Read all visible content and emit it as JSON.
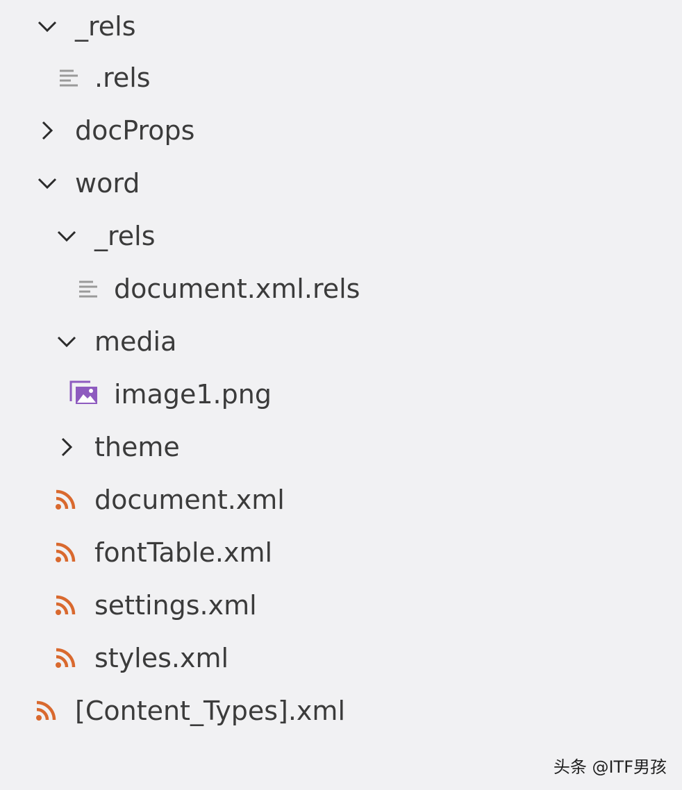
{
  "tree": {
    "items": [
      {
        "label": "_rels",
        "icon": "chevron-down-icon"
      },
      {
        "label": ".rels",
        "icon": "text-file-icon"
      },
      {
        "label": "docProps",
        "icon": "chevron-right-icon"
      },
      {
        "label": "word",
        "icon": "chevron-down-icon"
      },
      {
        "label": "_rels",
        "icon": "chevron-down-icon"
      },
      {
        "label": "document.xml.rels",
        "icon": "text-file-icon"
      },
      {
        "label": "media",
        "icon": "chevron-down-icon"
      },
      {
        "label": "image1.png",
        "icon": "image-file-icon"
      },
      {
        "label": "theme",
        "icon": "chevron-right-icon"
      },
      {
        "label": "document.xml",
        "icon": "xml-rss-icon"
      },
      {
        "label": "fontTable.xml",
        "icon": "xml-rss-icon"
      },
      {
        "label": "settings.xml",
        "icon": "xml-rss-icon"
      },
      {
        "label": "styles.xml",
        "icon": "xml-rss-icon"
      },
      {
        "label": "[Content_Types].xml",
        "icon": "xml-rss-icon"
      }
    ]
  },
  "watermark": {
    "text": "头条 @ITF男孩"
  },
  "colors": {
    "background": "#f1f1f3",
    "text": "#3b3b3b",
    "chevron": "#2b2b2b",
    "text_file_icon": "#9a9a9a",
    "image_icon": "#8e5bbf",
    "xml_icon": "#d9692e"
  }
}
